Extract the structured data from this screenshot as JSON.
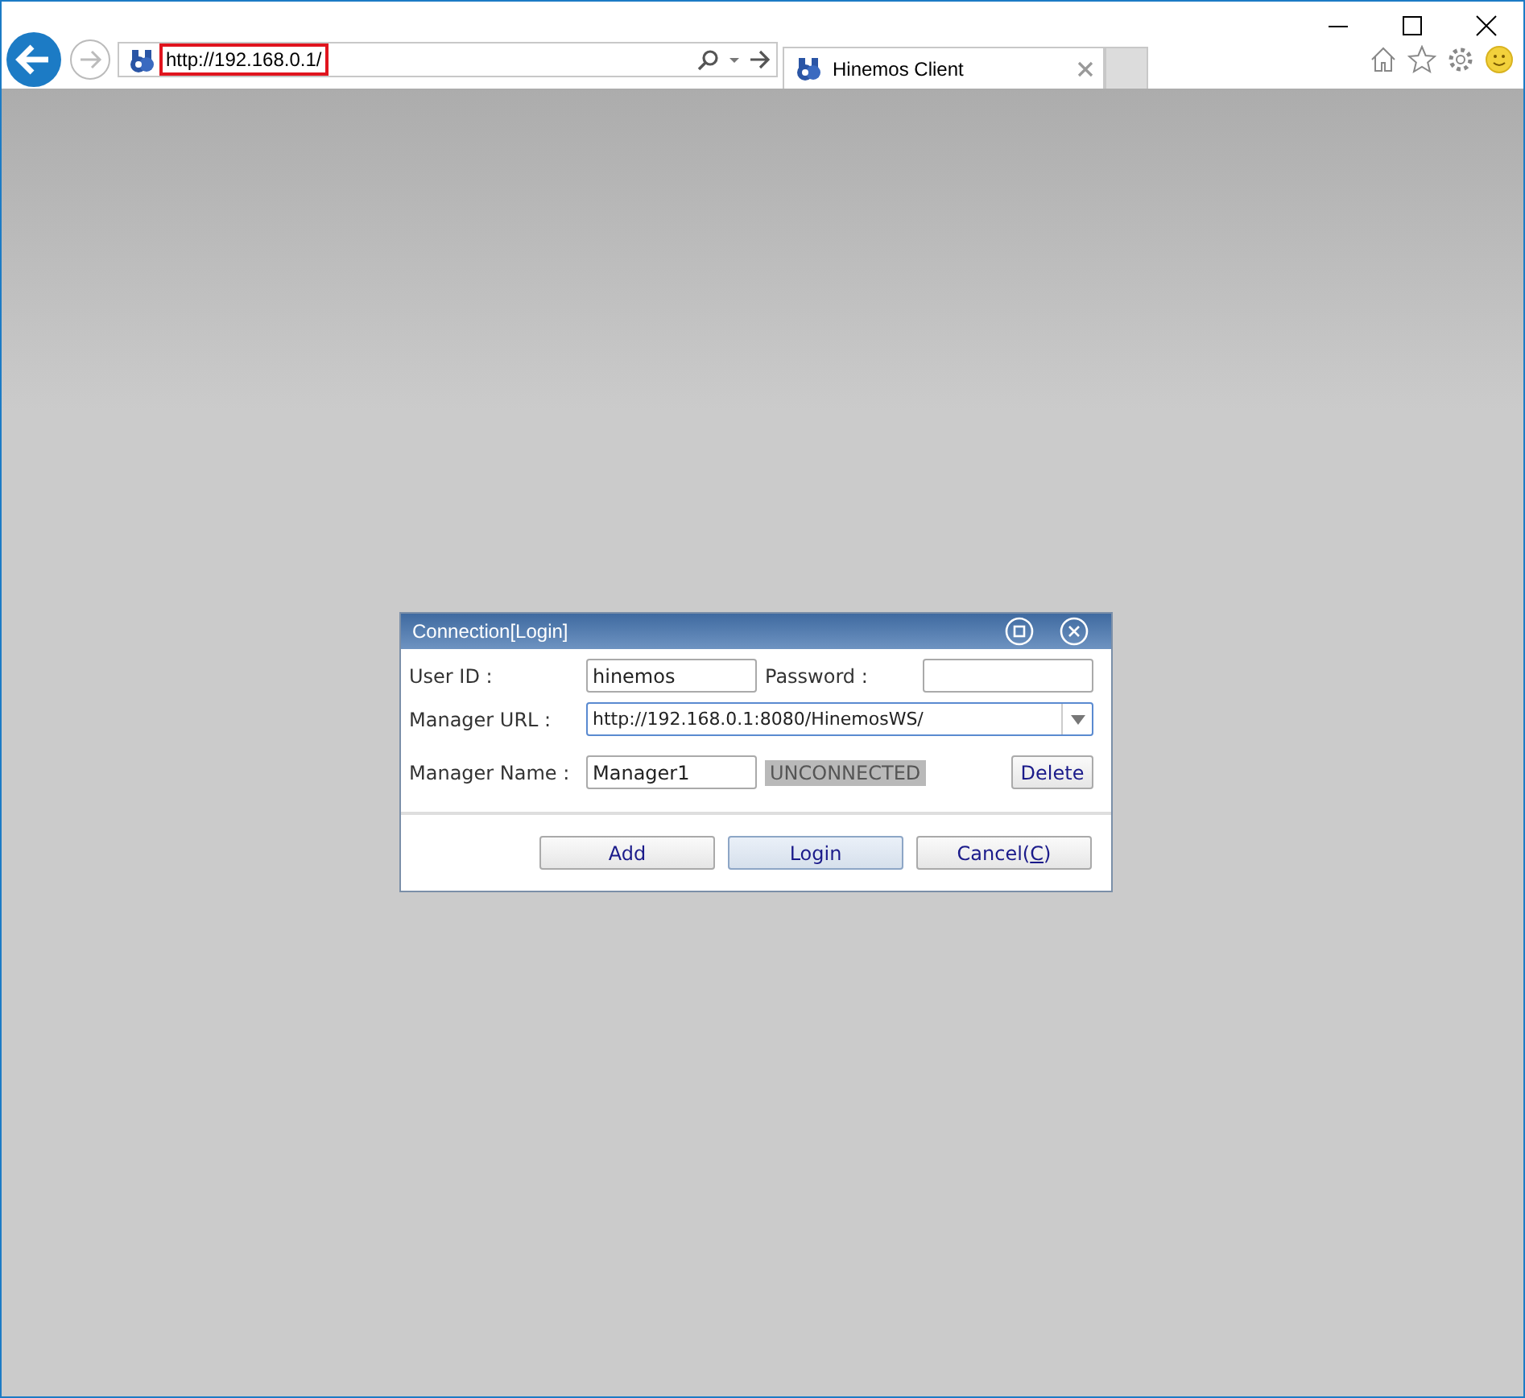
{
  "browser": {
    "address": {
      "value": "http://192.168.0.1/",
      "highlighted": true
    },
    "tab": {
      "title": "Hinemos Client",
      "selected": true
    }
  },
  "dialog": {
    "title": "Connection[Login]",
    "fields": [
      {
        "label": "User ID :",
        "value": "hinemos"
      },
      {
        "label": "Password :"
      },
      {
        "label": "Manager URL :",
        "value": "http://192.168.0.1:8080/HinemosWS/",
        "focused": true
      },
      {
        "label": "Manager Name :",
        "value": "Manager1"
      }
    ],
    "status": "UNCONNECTED",
    "delete_button": "Delete",
    "buttons": [
      {
        "label": "Add",
        "default": false
      },
      {
        "label": "Login",
        "default": true
      },
      {
        "label": "Cancel(C)",
        "default": false,
        "mnemonic": true
      }
    ]
  }
}
